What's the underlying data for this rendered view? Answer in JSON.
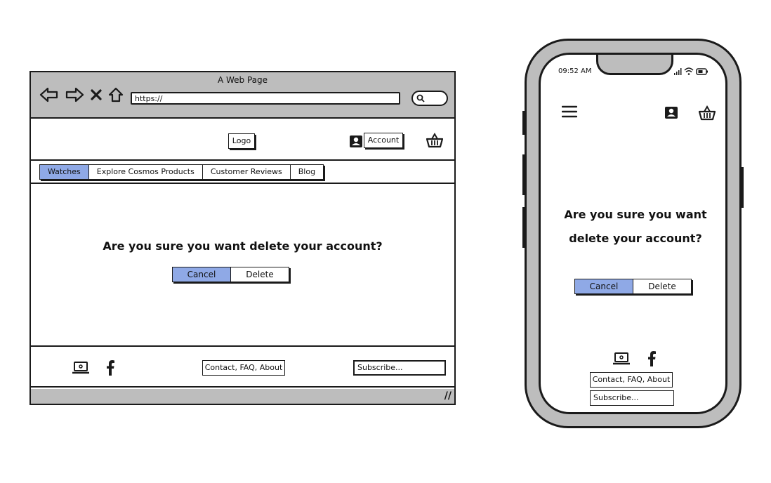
{
  "browser": {
    "title": "A Web Page",
    "url": "https://",
    "logo_label": "Logo",
    "account_label": "Account",
    "tabs": [
      {
        "label": "Watches",
        "active": true
      },
      {
        "label": "Explore Cosmos Products",
        "active": false
      },
      {
        "label": "Customer Reviews",
        "active": false
      },
      {
        "label": "Blog",
        "active": false
      }
    ],
    "question": "Are you sure you want delete your account?",
    "cancel_label": "Cancel",
    "delete_label": "Delete",
    "footer_links": "Contact, FAQ, About",
    "subscribe_placeholder": "Subscribe...",
    "resize_glyph": "//"
  },
  "phone": {
    "time": "09:52 AM",
    "question": "Are you sure you want delete your account?",
    "cancel_label": "Cancel",
    "delete_label": "Delete",
    "footer_links": "Contact, FAQ, About",
    "subscribe_placeholder": "Subscribe..."
  },
  "icons": {
    "back": "back-arrow-icon",
    "forward": "forward-arrow-icon",
    "stop": "close-icon",
    "home": "home-icon",
    "search": "search-icon",
    "account": "user-icon",
    "basket": "basket-icon",
    "laptop": "laptop-icon",
    "facebook": "facebook-icon",
    "menu": "hamburger-menu-icon",
    "signal": "signal-icon",
    "wifi": "wifi-icon",
    "battery": "battery-icon"
  },
  "colors": {
    "accent": "#8fa9e6",
    "chrome": "#bdbdbd",
    "stroke": "#1a1a1a"
  }
}
